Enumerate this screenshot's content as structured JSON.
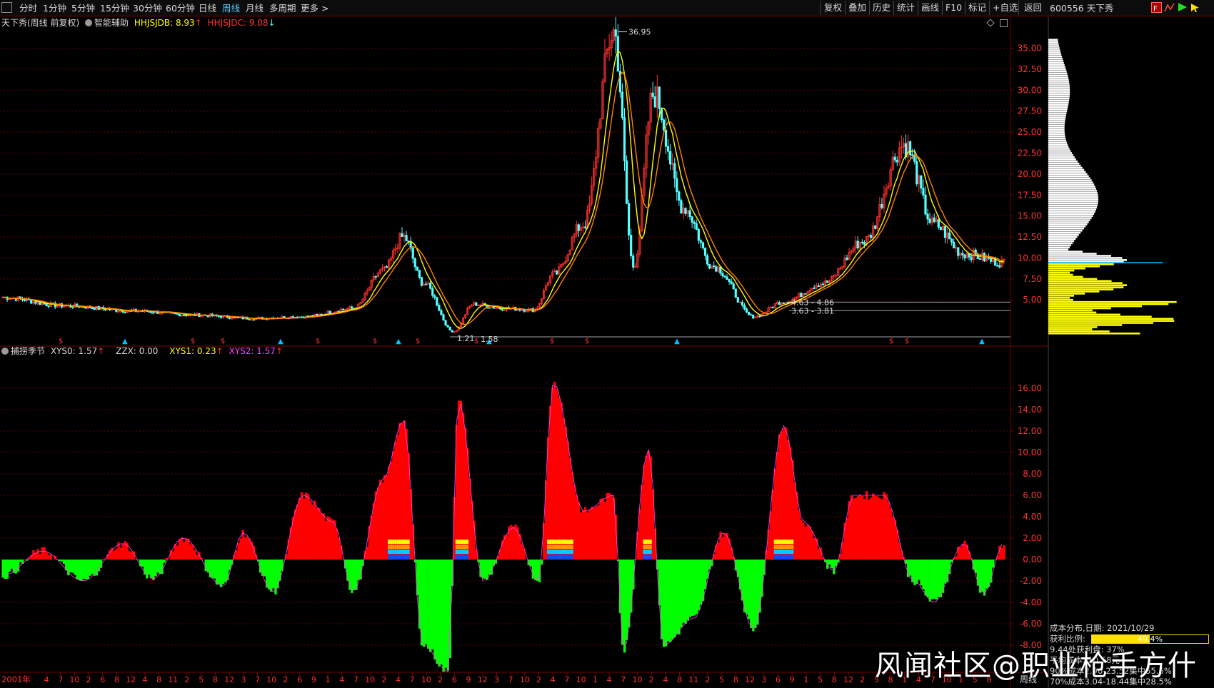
{
  "toolbar": {
    "periods": [
      {
        "label": "分时",
        "active": false
      },
      {
        "label": "1分钟",
        "active": false
      },
      {
        "label": "5分钟",
        "active": false
      },
      {
        "label": "15分钟",
        "active": false
      },
      {
        "label": "30分钟",
        "active": false
      },
      {
        "label": "60分钟",
        "active": false
      },
      {
        "label": "日线",
        "active": false
      },
      {
        "label": "周线",
        "active": true
      },
      {
        "label": "月线",
        "active": false
      },
      {
        "label": "多周期",
        "active": false
      },
      {
        "label": "更多 >",
        "active": false
      }
    ],
    "right_buttons": [
      "复权",
      "叠加",
      "历史",
      "统计",
      "画线",
      "F10",
      "标记",
      "+自选",
      "返回"
    ],
    "stock_code": "600556 天下秀"
  },
  "main_legend": {
    "title": "天下秀(周线 前复权)",
    "indicator": "智能辅助",
    "hhjsjdb_label": "HHJSJDB:",
    "hhjsjdb_value": "8.93",
    "hhjsjdc_label": "HHJSJDC:",
    "hhjsjdc_value": "9.08"
  },
  "sub_legend": {
    "name": "捕捞季节",
    "xys0_label": "XYS0:",
    "xys0_value": "1.57",
    "zzx_label": "ZZX:",
    "zzx_value": "0.00",
    "xys1_label": "XYS1:",
    "xys1_value": "0.23",
    "xys2_label": "XYS2:",
    "xys2_value": "1.57"
  },
  "main_axis_ticks": [
    "35.00",
    "32.50",
    "30.00",
    "27.50",
    "25.00",
    "22.50",
    "20.00",
    "17.50",
    "15.00",
    "12.50",
    "10.00",
    "7.50",
    "5.00"
  ],
  "sub_axis_ticks": [
    "16.00",
    "14.00",
    "12.00",
    "10.00",
    "8.00",
    "6.00",
    "4.00",
    "2.00",
    "0.00",
    "-2.00",
    "-4.00",
    "-6.00",
    "-8.00"
  ],
  "annotations": {
    "high": "36.95",
    "low1": "1.21",
    "low2": "1.58",
    "range1": "4.63 - 4.86",
    "range2": "3.63 - 3.81"
  },
  "time_axis": {
    "year_label": "2001年",
    "ticks": [
      "4",
      "7",
      "10",
      "2",
      "6",
      "8",
      "12",
      "4",
      "8",
      "11",
      "2",
      "5",
      "8",
      "12",
      "3",
      "7",
      "10",
      "2",
      "6",
      "9",
      "1",
      "4",
      "7",
      "10",
      "2",
      "4",
      "7",
      "10",
      "2",
      "6",
      "9",
      "12",
      "3",
      "7",
      "10",
      "2",
      "4",
      "7",
      "10",
      "1",
      "4",
      "7",
      "10",
      "2",
      "4",
      "8",
      "11",
      "2",
      "5",
      "8",
      "12",
      "3",
      "6",
      "9",
      "1",
      "5",
      "8",
      "12",
      "2",
      "5",
      "8",
      "1",
      "4",
      "7",
      "10",
      "1",
      "5",
      "8"
    ],
    "period_label": "周线"
  },
  "cost_panel": {
    "title": "成本分布,日期: 2021/10/29",
    "profit_label": "获利比例:",
    "profit_value": "49.4%",
    "profit_ratio": 0.494,
    "line3": "9.44处获利盘: 37%",
    "line4": "平均成本: 10.58元",
    "line5": "90%成本2.96-23.52集中55.6%",
    "line6": "70%成本3.04-18.44集中28.5%"
  },
  "watermark": "风闻社区@职业枪手方什",
  "colors": {
    "up": "#ff3232",
    "down": "#54ffff",
    "ma_yellow": "#ffff00",
    "ma_orange": "#ff8000",
    "grid_red": "#7a0000",
    "hist_red": "#ff0000",
    "hist_green": "#00ff00",
    "cost_yellow": "#ffff00",
    "cost_white": "#ffffff"
  },
  "chart_data": {
    "type": "line",
    "title": "天下秀(周线 前复权)",
    "price_ylim": [
      0,
      37
    ],
    "price_milestones": [
      {
        "t": 0,
        "price": 5.3
      },
      {
        "t": 0.06,
        "price": 4.3
      },
      {
        "t": 0.13,
        "price": 3.7
      },
      {
        "t": 0.19,
        "price": 3.2
      },
      {
        "t": 0.25,
        "price": 2.8
      },
      {
        "t": 0.3,
        "price": 3.0
      },
      {
        "t": 0.35,
        "price": 4.0
      },
      {
        "t": 0.38,
        "price": 8.5
      },
      {
        "t": 0.4,
        "price": 12.5
      },
      {
        "t": 0.42,
        "price": 7.0
      },
      {
        "t": 0.45,
        "price": 1.21
      },
      {
        "t": 0.47,
        "price": 4.5
      },
      {
        "t": 0.5,
        "price": 4.0
      },
      {
        "t": 0.53,
        "price": 3.8
      },
      {
        "t": 0.55,
        "price": 8.0
      },
      {
        "t": 0.58,
        "price": 14.0
      },
      {
        "t": 0.61,
        "price": 36.95
      },
      {
        "t": 0.63,
        "price": 9.0
      },
      {
        "t": 0.65,
        "price": 29.5
      },
      {
        "t": 0.68,
        "price": 16.0
      },
      {
        "t": 0.71,
        "price": 9.0
      },
      {
        "t": 0.75,
        "price": 3.0
      },
      {
        "t": 0.78,
        "price": 4.8
      },
      {
        "t": 0.82,
        "price": 7.0
      },
      {
        "t": 0.86,
        "price": 12.0
      },
      {
        "t": 0.9,
        "price": 23.5
      },
      {
        "t": 0.93,
        "price": 14.0
      },
      {
        "t": 0.96,
        "price": 10.5
      },
      {
        "t": 1.0,
        "price": 9.44
      }
    ],
    "oscillator_ylim": [
      -10,
      18
    ],
    "oscillator_peaks": [
      {
        "t": 0.0,
        "v": -1.5
      },
      {
        "t": 0.04,
        "v": 0.8
      },
      {
        "t": 0.08,
        "v": -2.0
      },
      {
        "t": 0.12,
        "v": 1.5
      },
      {
        "t": 0.15,
        "v": -1.8
      },
      {
        "t": 0.18,
        "v": 2.0
      },
      {
        "t": 0.22,
        "v": -2.5
      },
      {
        "t": 0.24,
        "v": 2.5
      },
      {
        "t": 0.27,
        "v": -3.0
      },
      {
        "t": 0.3,
        "v": 6.0
      },
      {
        "t": 0.33,
        "v": 3.5
      },
      {
        "t": 0.35,
        "v": -3.0
      },
      {
        "t": 0.38,
        "v": 7.5
      },
      {
        "t": 0.4,
        "v": 13.0
      },
      {
        "t": 0.42,
        "v": -8.0
      },
      {
        "t": 0.445,
        "v": -10.5
      },
      {
        "t": 0.455,
        "v": 15.0
      },
      {
        "t": 0.48,
        "v": -2.0
      },
      {
        "t": 0.51,
        "v": 3.0
      },
      {
        "t": 0.535,
        "v": -2.0
      },
      {
        "t": 0.55,
        "v": 16.5
      },
      {
        "t": 0.58,
        "v": 4.5
      },
      {
        "t": 0.61,
        "v": 6.0
      },
      {
        "t": 0.62,
        "v": -8.5
      },
      {
        "t": 0.645,
        "v": 10.3
      },
      {
        "t": 0.66,
        "v": -8.0
      },
      {
        "t": 0.69,
        "v": -5.5
      },
      {
        "t": 0.72,
        "v": 2.5
      },
      {
        "t": 0.75,
        "v": -6.5
      },
      {
        "t": 0.78,
        "v": 12.5
      },
      {
        "t": 0.8,
        "v": 3.5
      },
      {
        "t": 0.83,
        "v": -1.0
      },
      {
        "t": 0.85,
        "v": 6.0
      },
      {
        "t": 0.88,
        "v": 6.0
      },
      {
        "t": 0.91,
        "v": -2.0
      },
      {
        "t": 0.93,
        "v": -4.0
      },
      {
        "t": 0.96,
        "v": 1.5
      },
      {
        "t": 0.98,
        "v": -3.2
      },
      {
        "t": 1.0,
        "v": 1.57
      }
    ]
  }
}
